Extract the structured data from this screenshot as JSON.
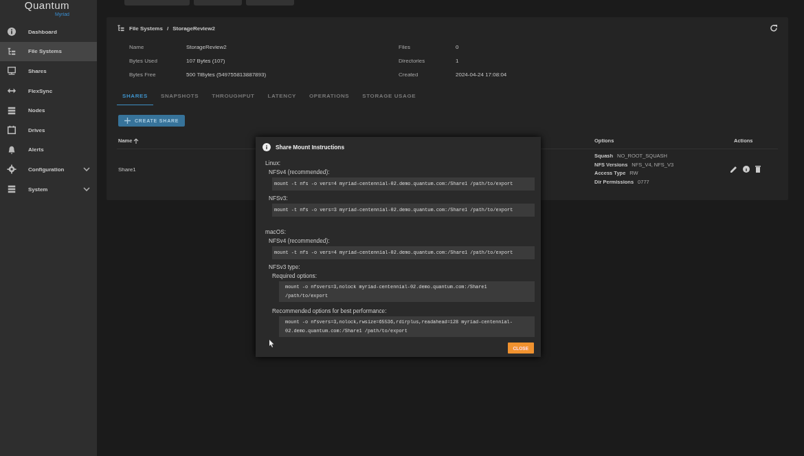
{
  "logo": {
    "name": "Quantum",
    "product": "Myriad"
  },
  "sidebar": {
    "items": [
      {
        "label": "Dashboard",
        "selected": false,
        "expandable": false
      },
      {
        "label": "File Systems",
        "selected": true,
        "expandable": false
      },
      {
        "label": "Shares",
        "selected": false,
        "expandable": false
      },
      {
        "label": "FlexSync",
        "selected": false,
        "expandable": false
      },
      {
        "label": "Nodes",
        "selected": false,
        "expandable": false
      },
      {
        "label": "Drives",
        "selected": false,
        "expandable": false
      },
      {
        "label": "Alerts",
        "selected": false,
        "expandable": false
      },
      {
        "label": "Configuration",
        "selected": false,
        "expandable": true
      },
      {
        "label": "System",
        "selected": false,
        "expandable": true
      }
    ]
  },
  "breadcrumb": [
    "File Systems",
    "/",
    "StorageReview2"
  ],
  "details_left": [
    {
      "label": "Name",
      "value": "StorageReview2"
    },
    {
      "label": "Bytes Used",
      "value": "107 Bytes (107)"
    },
    {
      "label": "Bytes Free",
      "value": "500 TiBytes (549755813887893)"
    }
  ],
  "details_right": [
    {
      "label": "Files",
      "value": "0"
    },
    {
      "label": "Directories",
      "value": "1"
    },
    {
      "label": "Created",
      "value": "2024-04-24 17:08:04"
    }
  ],
  "tabs": [
    {
      "label": "SHARES",
      "selected": true
    },
    {
      "label": "SNAPSHOTS",
      "selected": false
    },
    {
      "label": "THROUGHPUT",
      "selected": false
    },
    {
      "label": "LATENCY",
      "selected": false
    },
    {
      "label": "OPERATIONS",
      "selected": false
    },
    {
      "label": "STORAGE USAGE",
      "selected": false
    }
  ],
  "create_button": "CREATE SHARE",
  "table": {
    "columns": [
      {
        "label": "Name",
        "sorted": true
      },
      {
        "label": "Options",
        "sorted": false
      },
      {
        "label": "Actions",
        "sorted": false
      }
    ],
    "rows": [
      {
        "name": "Share1",
        "options": [
          {
            "label": "Squash",
            "value": "NO_ROOT_SQUASH"
          },
          {
            "label": "NFS Versions",
            "value": "NFS_V4, NFS_V3"
          },
          {
            "label": "Access Type",
            "value": "RW"
          },
          {
            "label": "Dir Permissions",
            "value": "0777"
          }
        ]
      }
    ]
  },
  "modal": {
    "title": "Share Mount Instructions",
    "lines": [
      {
        "kind": "os",
        "text": "Linux:"
      },
      {
        "kind": "variant",
        "text": "NFSv4 (recommended):"
      },
      {
        "kind": "code",
        "text": "mount -t nfs -o vers=4 myriad-centennial-02.demo.quantum.com:/Share1 /path/to/export"
      },
      {
        "kind": "variant",
        "text": "NFSv3:"
      },
      {
        "kind": "code",
        "text": "mount -t nfs -o vers=3 myriad-centennial-02.demo.quantum.com:/Share1 /path/to/export"
      },
      {
        "kind": "os",
        "text": "macOS:"
      },
      {
        "kind": "variant",
        "text": "NFSv4 (recommended):"
      },
      {
        "kind": "code",
        "text": "mount -t nfs -o vers=4 myriad-centennial-02.demo.quantum.com:/Share1 /path/to/export"
      },
      {
        "kind": "variant",
        "text": "NFSv3 type:"
      },
      {
        "kind": "option",
        "text": "Required options:"
      },
      {
        "kind": "option-code",
        "text": "mount -o nfsvers=3,nolock myriad-centennial-02.demo.quantum.com:/Share1 /path/to/export"
      },
      {
        "kind": "option",
        "text": "Recommended options for best performance:"
      },
      {
        "kind": "option-code",
        "text": "mount -o nfsvers=3,nolock,rwsize=65536,rdirplus,readahead=128 myriad-centennial-02.demo.quantum.com:/Share1 /path/to/export"
      }
    ],
    "close": "CLOSE"
  }
}
